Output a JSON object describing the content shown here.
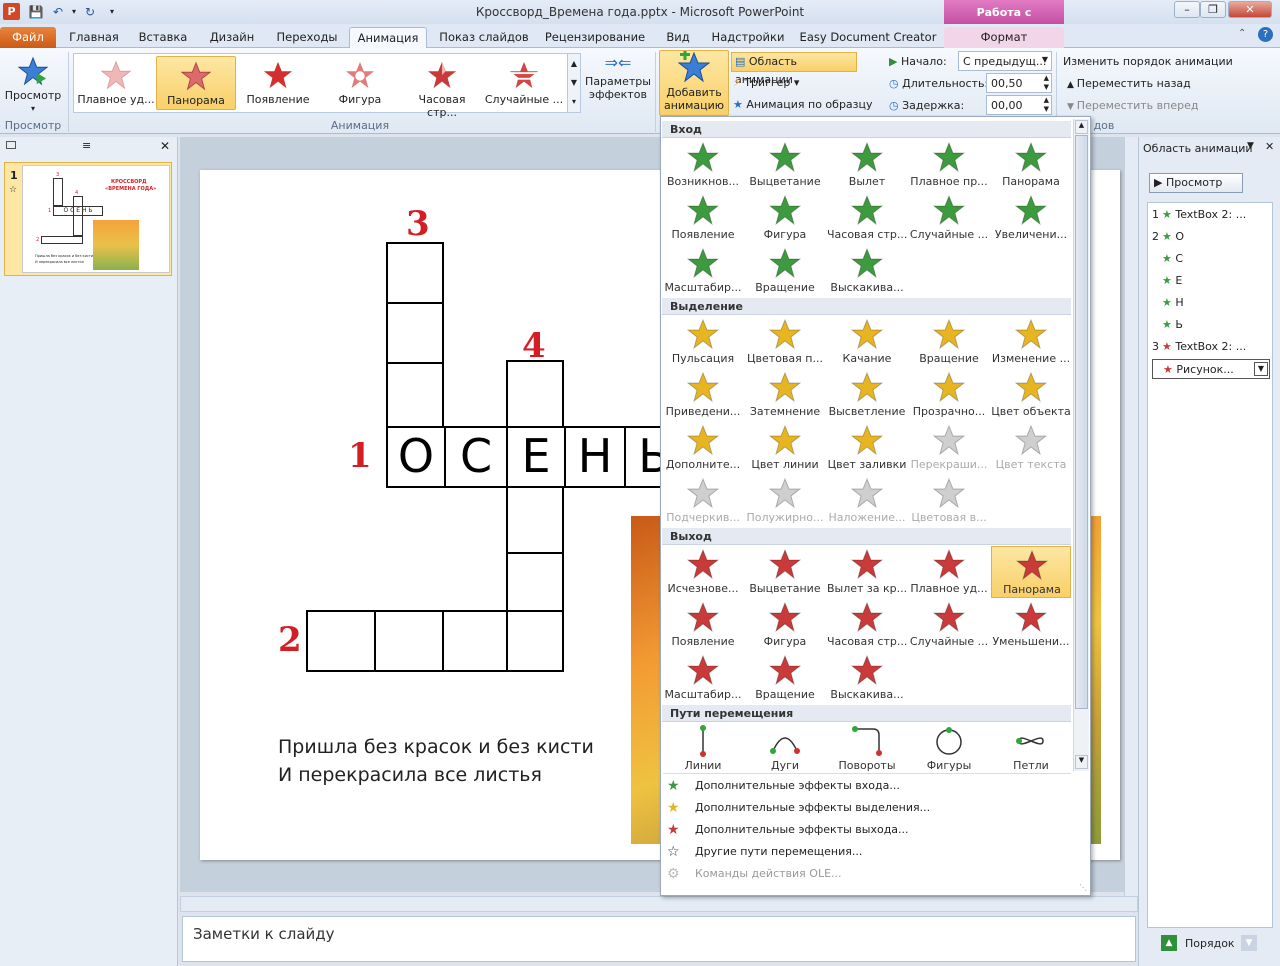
{
  "app": {
    "title": "Кроссворд_Времена года.pptx - Microsoft PowerPoint",
    "context_tab_header": "Работа с рисунками"
  },
  "tabs": [
    "Файл",
    "Главная",
    "Вставка",
    "Дизайн",
    "Переходы",
    "Анимация",
    "Показ слайдов",
    "Рецензирование",
    "Вид",
    "Надстройки",
    "Easy Document Creator",
    "Формат"
  ],
  "ribbon": {
    "preview_label": "Просмотр",
    "preview_group": "Просмотр",
    "animation_group": "Анимация",
    "gallery": [
      "Плавное уд...",
      "Панорама",
      "Появление",
      "Фигура",
      "Часовая стр...",
      "Случайные ..."
    ],
    "effect_options": "Параметры эффектов",
    "add_animation": "Добавить анимацию",
    "animation_pane": "Область анимации",
    "trigger": "Триггер",
    "painter": "Анимация по образцу",
    "start_label": "Начало:",
    "start_value": "С предыдущ...",
    "duration_label": "Длительность:",
    "duration_value": "00,50",
    "delay_label": "Задержка:",
    "delay_value": "00,00",
    "reorder_title": "Изменить порядок анимации",
    "move_earlier": "Переместить назад",
    "move_later": "Переместить вперед",
    "timing_group_tail": "дов"
  },
  "slide": {
    "number": "1",
    "numbers": [
      "1",
      "2",
      "3",
      "4"
    ],
    "letters": [
      "О",
      "С",
      "Е",
      "Н",
      "Ь"
    ],
    "poem_line1": "Пришла без красок и без кисти",
    "poem_line2": "И перекрасила все листья",
    "thumb_title1": "КРОССВОРД",
    "thumb_title2": "«ВРЕМЕНА ГОДА»",
    "thumb_letters": "О С Е Н Ь",
    "thumb_poem1": "Пришла без красок и без кисти",
    "thumb_poem2": "И перекрасила все листья",
    "thumb_nums": [
      "1",
      "2",
      "3",
      "4"
    ]
  },
  "notes": "Заметки к слайду",
  "animpane": {
    "title": "Область анимации",
    "play": "Просмотр",
    "order": "Порядок",
    "items": [
      {
        "num": "1",
        "label": "TextBox 2: ..."
      },
      {
        "num": "2",
        "label": "О"
      },
      {
        "num": "",
        "label": "С"
      },
      {
        "num": "",
        "label": "Е"
      },
      {
        "num": "",
        "label": "Н"
      },
      {
        "num": "",
        "label": "Ь"
      },
      {
        "num": "3",
        "label": "TextBox 2: ..."
      },
      {
        "num": "",
        "label": "Рисунок..."
      }
    ]
  },
  "dropdown": {
    "sections": [
      "Вход",
      "Выделение",
      "Выход",
      "Пути перемещения"
    ],
    "entrance": [
      "Возникнов...",
      "Выцветание",
      "Вылет",
      "Плавное пр...",
      "Панорама",
      "Появление",
      "Фигура",
      "Часовая стр...",
      "Случайные ...",
      "Увеличени...",
      "Масштабир...",
      "Вращение",
      "Выскакива..."
    ],
    "emphasis": [
      "Пульсация",
      "Цветовая п...",
      "Качание",
      "Вращение",
      "Изменение ...",
      "Приведени...",
      "Затемнение",
      "Высветление",
      "Прозрачно...",
      "Цвет объекта",
      "Дополните...",
      "Цвет линии",
      "Цвет заливки",
      "Перекраши...",
      "Цвет текста",
      "Подчеркив...",
      "Полужирно...",
      "Наложение...",
      "Цветовая в..."
    ],
    "exit": [
      "Исчезнове...",
      "Выцветание",
      "Вылет за кр...",
      "Плавное уд...",
      "Панорама",
      "Появление",
      "Фигура",
      "Часовая стр...",
      "Случайные ...",
      "Уменьшени...",
      "Масштабир...",
      "Вращение",
      "Выскакива..."
    ],
    "paths": [
      "Линии",
      "Дуги",
      "Повороты",
      "Фигуры",
      "Петли"
    ],
    "more": [
      "Дополнительные эффекты входа...",
      "Дополнительные эффекты выделения...",
      "Дополнительные эффекты выхода...",
      "Другие пути перемещения...",
      "Команды действия OLE..."
    ]
  },
  "colors": {
    "entrance": "#3e9a3e",
    "emphasis": "#e8b522",
    "exit": "#c93a3a",
    "accent_file": "#d9692a",
    "context": "#d562b4",
    "number_red": "#d41e25"
  }
}
